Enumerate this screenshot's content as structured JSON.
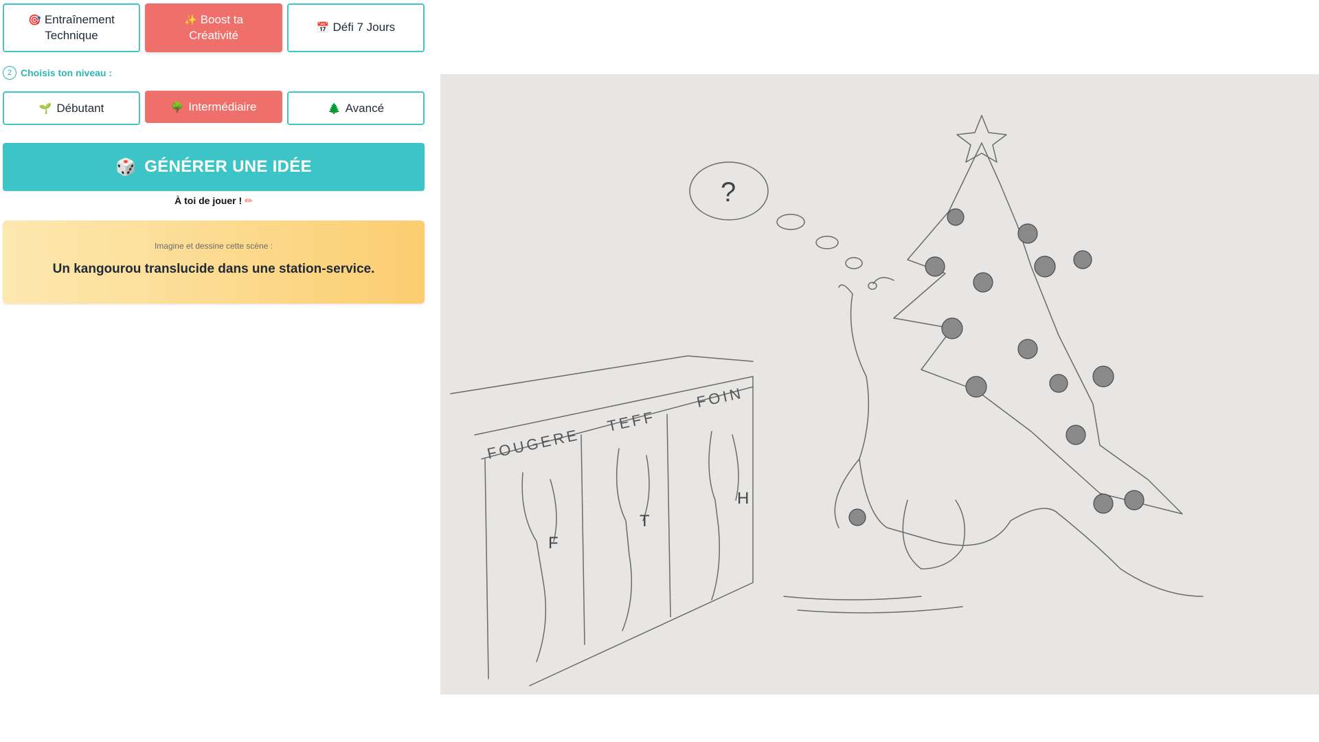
{
  "modes": [
    {
      "icon": "target-icon",
      "glyph": "🎯",
      "label_line1": "Entraînement",
      "label_line2": "Technique",
      "active": false
    },
    {
      "icon": "sparkles-icon",
      "glyph": "✨",
      "label_line1": "Boost ta",
      "label_line2": "Créativité",
      "active": true
    },
    {
      "icon": "calendar-icon",
      "glyph": "📅",
      "label_line1": "Défi 7 Jours",
      "label_line2": "",
      "active": false
    }
  ],
  "level_step": {
    "number": "2",
    "label": "Choisis ton niveau :"
  },
  "levels": [
    {
      "icon": "seedling-icon",
      "glyph": "🌱",
      "label": "Débutant",
      "active": false
    },
    {
      "icon": "tree-icon",
      "glyph": "🌳",
      "label": "Intermédiaire",
      "active": true
    },
    {
      "icon": "evergreen-icon",
      "glyph": "🌲",
      "label": "Avancé",
      "active": false
    }
  ],
  "generate": {
    "icon": "dice-icon",
    "glyph": "🎲",
    "label": "GÉNÉRER UNE IDÉE"
  },
  "your_turn": {
    "text": "À toi de jouer !",
    "icon": "pencil-icon",
    "glyph": "✏"
  },
  "idea_card": {
    "hint": "Imagine et dessine cette scène :",
    "idea": "Un kangourou translucide dans une station-service."
  },
  "drawing": {
    "pump_labels": [
      "FOUGERE",
      "TEFF",
      "FOIN"
    ],
    "nozzle_letters": [
      "F",
      "T",
      "H"
    ],
    "thought": "?"
  },
  "colors": {
    "accent_teal": "#3cc4c6",
    "active_coral": "#ef6f6b",
    "card_yellow": "#fcd98b"
  }
}
